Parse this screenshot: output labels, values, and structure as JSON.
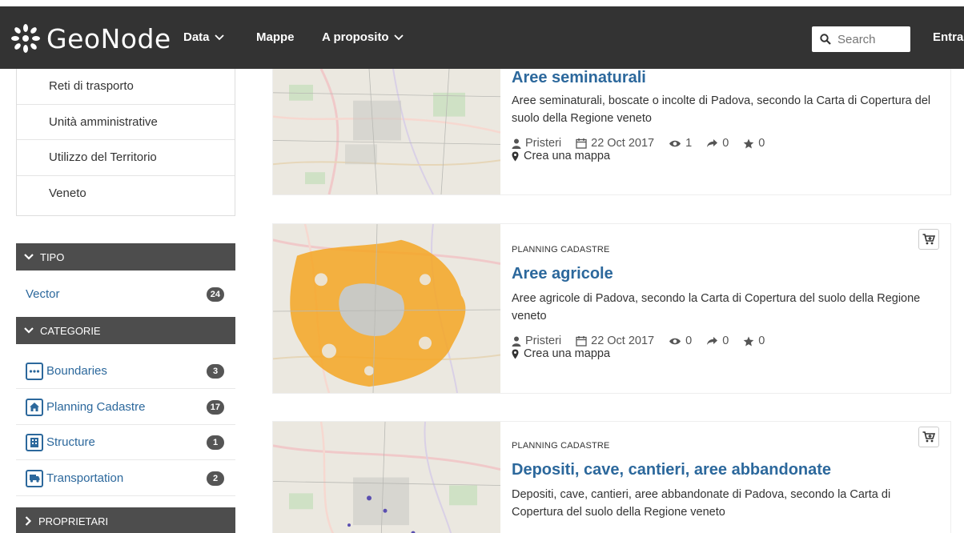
{
  "navbar": {
    "brand": "GeoNode",
    "menu": [
      {
        "label": "Data",
        "has_dropdown": true
      },
      {
        "label": "Mappe",
        "has_dropdown": false
      },
      {
        "label": "A proposito",
        "has_dropdown": true
      }
    ],
    "search": {
      "placeholder": "Search",
      "icon": "search-icon"
    },
    "login_label": "Entra"
  },
  "regions": {
    "items": [
      "Reti di trasporto",
      "Unità amministrative",
      "Utilizzo del Territorio",
      "Veneto"
    ]
  },
  "facets": {
    "tipo": {
      "label": "TIPO",
      "items": [
        {
          "label": "Vector",
          "count": "24"
        }
      ]
    },
    "categorie": {
      "label": "CATEGORIE",
      "items": [
        {
          "label": "Boundaries",
          "count": "3",
          "icon": "boundaries-icon"
        },
        {
          "label": "Planning Cadastre",
          "count": "17",
          "icon": "home-icon"
        },
        {
          "label": "Structure",
          "count": "1",
          "icon": "building-icon"
        },
        {
          "label": "Transportation",
          "count": "2",
          "icon": "truck-icon"
        }
      ]
    },
    "proprietari": {
      "label": "PROPRIETARI"
    }
  },
  "results": [
    {
      "category": "",
      "title": "Aree seminaturali",
      "abstract": "Aree seminaturali, boscate o incolte di Padova, secondo la Carta di Copertura del suolo della Regione veneto",
      "owner": "Pristeri",
      "date": "22 Oct 2017",
      "views": "1",
      "shares": "0",
      "rating": "0",
      "map_link": "Crea una mappa"
    },
    {
      "category": "PLANNING CADASTRE",
      "title": "Aree agricole",
      "abstract": "Aree agricole di Padova, secondo la Carta di Copertura del suolo della Regione veneto",
      "owner": "Pristeri",
      "date": "22 Oct 2017",
      "views": "0",
      "shares": "0",
      "rating": "0",
      "map_link": "Crea una mappa"
    },
    {
      "category": "PLANNING CADASTRE",
      "title": "Depositi, cave, cantieri, aree abbandonate",
      "abstract": "Depositi, cave, cantieri, aree abbandonate di Padova, secondo la Carta di Copertura del suolo della Regione veneto"
    }
  ],
  "colors": {
    "navbar": "#333333",
    "link": "#2c689c",
    "facet_header": "#4d4d4d",
    "agri_overlay": "#f5a623"
  }
}
